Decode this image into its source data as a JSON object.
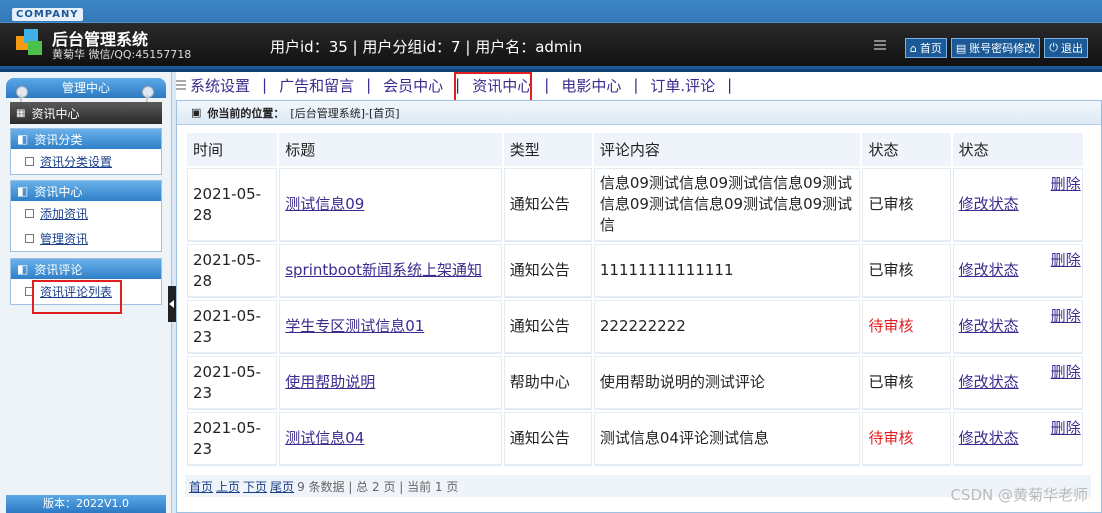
{
  "header": {
    "company": "COMPANY",
    "title": "后台管理系统",
    "subtitle": "黄菊华 微信/QQ:45157718",
    "user_info": "用户id：35 | 用户分组id：7 | 用户名：admin",
    "links": [
      {
        "label": "首页",
        "icon": "home-icon"
      },
      {
        "label": "账号密码修改",
        "icon": "form-icon"
      },
      {
        "label": "退出",
        "icon": "power-icon"
      }
    ]
  },
  "sidebar": {
    "mgmt_title": "管理中心",
    "current": "资讯中心",
    "groups": [
      {
        "title": "资讯分类",
        "items": [
          "资讯分类设置"
        ]
      },
      {
        "title": "资讯中心",
        "items": [
          "添加资讯",
          "管理资讯"
        ]
      },
      {
        "title": "资讯评论",
        "items": [
          "资讯评论列表"
        ]
      }
    ],
    "version": "版本：2022V1.0"
  },
  "menu": {
    "items": [
      "系统设置",
      "广告和留言",
      "会员中心",
      "资讯中心",
      "电影中心",
      "订单.评论"
    ],
    "active_index": 3
  },
  "main": {
    "location_label": "你当前的位置：",
    "location_path": "[后台管理系统]-[首页]",
    "columns": [
      "时间",
      "标题",
      "类型",
      "评论内容",
      "状态",
      "状态"
    ],
    "rows": [
      {
        "time": "2021-05-28",
        "title": "测试信息09",
        "type": "通知公告",
        "content": "信息09测试信息09测试信信息09测试信息09测试信信息09测试信息09测试信",
        "status": "已审核",
        "edit": "修改状态",
        "del": "删除"
      },
      {
        "time": "2021-05-28",
        "title": "sprintboot新闻系统上架通知",
        "type": "通知公告",
        "content": "11111111111111",
        "status": "已审核",
        "edit": "修改状态",
        "del": "删除"
      },
      {
        "time": "2021-05-23",
        "title": "学生专区测试信息01",
        "type": "通知公告",
        "content": "222222222",
        "status": "待审核",
        "edit": "修改状态",
        "del": "删除"
      },
      {
        "time": "2021-05-23",
        "title": "使用帮助说明",
        "type": "帮助中心",
        "content": "使用帮助说明的测试评论",
        "status": "已审核",
        "edit": "修改状态",
        "del": "删除"
      },
      {
        "time": "2021-05-23",
        "title": "测试信息04",
        "type": "通知公告",
        "content": "测试信息04评论测试信息",
        "status": "待审核",
        "edit": "修改状态",
        "del": "删除"
      }
    ],
    "pager": {
      "first": "首页",
      "prev": "上页",
      "next": "下页",
      "last": "尾页",
      "summary": "9 条数据 | 总 2 页 | 当前 1 页"
    }
  },
  "watermark": "CSDN @黄菊华老师",
  "colors": {
    "accent": "#2c78c2",
    "pending": "#e02020",
    "link": "#3d2a8f",
    "highlight": "#e02020"
  }
}
